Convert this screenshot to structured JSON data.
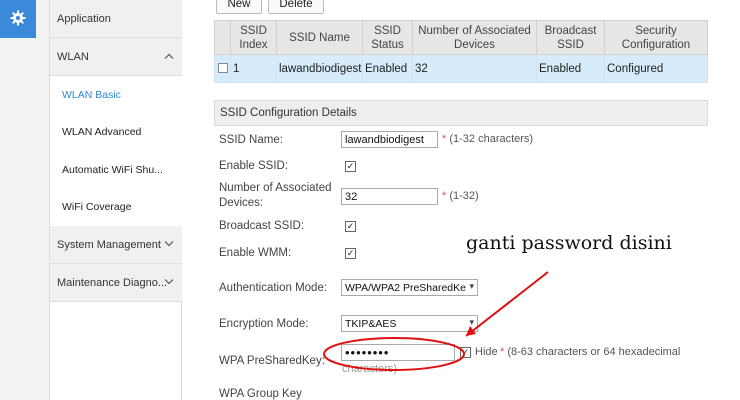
{
  "sidebar": {
    "menus": [
      {
        "label": "Application",
        "expanded": false
      },
      {
        "label": "WLAN",
        "expanded": true,
        "items": [
          {
            "label": "WLAN Basic",
            "active": true
          },
          {
            "label": "WLAN Advanced",
            "active": false
          },
          {
            "label": "Automatic WiFi Shu...",
            "active": false
          },
          {
            "label": "WiFi Coverage",
            "active": false
          }
        ]
      },
      {
        "label": "System Management",
        "expanded": false
      },
      {
        "label": "Maintenance Diagno...",
        "expanded": false
      }
    ]
  },
  "toolbar": {
    "new_label": "New",
    "delete_label": "Delete"
  },
  "ssid_table": {
    "headers": [
      "",
      "SSID Index",
      "SSID Name",
      "SSID Status",
      "Number of Associated Devices",
      "Broadcast SSID",
      "Security Configuration"
    ],
    "rows": [
      [
        "",
        "1",
        "lawandbiodigest",
        "Enabled",
        "32",
        "Enabled",
        "Configured"
      ]
    ]
  },
  "details": {
    "title": "SSID Configuration Details",
    "ssid_name_label": "SSID Name:",
    "ssid_name_value": "lawandbiodigest",
    "ssid_name_hint": "(1-32 characters)",
    "enable_ssid_label": "Enable SSID:",
    "num_devices_label_1": "Number of Associated",
    "num_devices_label_2": "Devices:",
    "num_devices_value": "32",
    "num_devices_hint": "(1-32)",
    "broadcast_label": "Broadcast SSID:",
    "wmm_label": "Enable WMM:",
    "auth_mode_label": "Authentication Mode:",
    "auth_mode_value": "WPA/WPA2 PreSharedKe",
    "enc_mode_label": "Encryption Mode:",
    "enc_mode_value": "TKIP&AES",
    "psk_label": "WPA PreSharedKey:",
    "psk_value": "••••••••",
    "hide_label": "Hide",
    "psk_hint": "(8-63 characters or 64 hexadecimal",
    "psk_hint_2": "characters)",
    "group_key_label": "WPA Group Key",
    "required_mark": "*"
  },
  "annotation": {
    "text": "ganti password disini"
  },
  "colors": {
    "accent": "#3a8ad9",
    "selected_row": "#d6ecfa",
    "annotation": "#e01010"
  }
}
